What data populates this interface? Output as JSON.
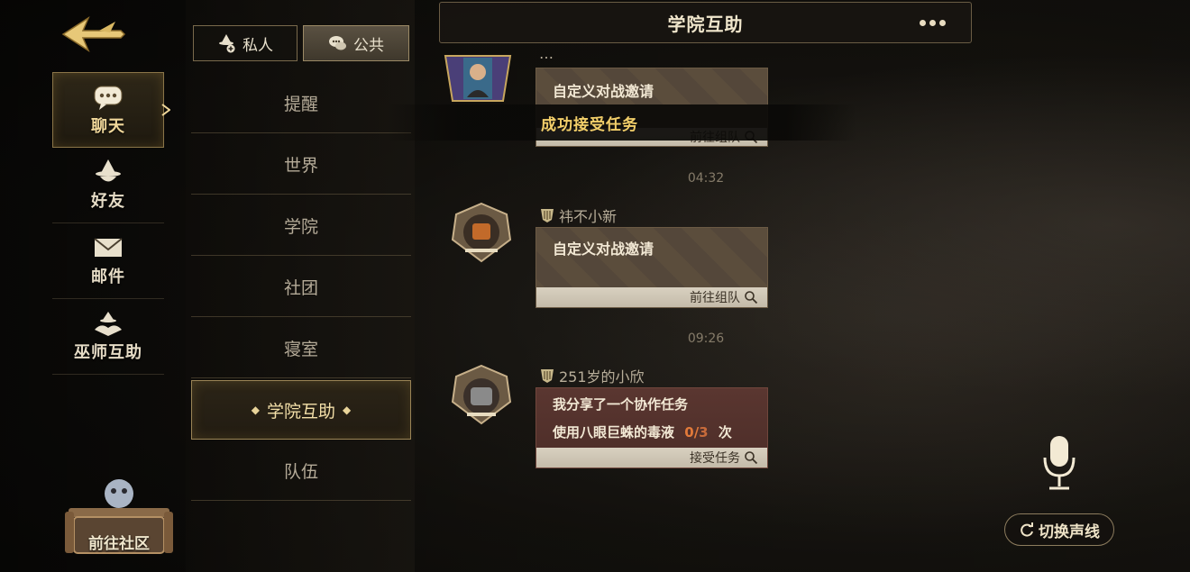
{
  "nav": {
    "items": [
      {
        "label": "聊天",
        "icon": "chat-bubble-icon"
      },
      {
        "label": "好友",
        "icon": "wizard-hat-icon"
      },
      {
        "label": "邮件",
        "icon": "envelope-icon"
      },
      {
        "label": "巫师互助",
        "icon": "wizard-help-icon"
      }
    ],
    "active_index": 0,
    "community_label": "前往社区"
  },
  "tabs": {
    "private_label": "私人",
    "public_label": "公共",
    "active": "public"
  },
  "channels": {
    "items": [
      "提醒",
      "世界",
      "学院",
      "社团",
      "寝室",
      "学院互助",
      "队伍"
    ],
    "active_index": 5
  },
  "chat": {
    "title": "学院互助",
    "messages": [
      {
        "sender": "…",
        "card_title": "自定义对战邀请",
        "action": "前往组队"
      },
      {
        "time": "04:32",
        "sender": "祎不小新",
        "card_title": "自定义对战邀请",
        "action": "前往组队"
      },
      {
        "time": "09:26",
        "sender": "251岁的小欣",
        "card_title": "我分享了一个协作任务",
        "task_text": "使用八眼巨蛛的毒液",
        "progress_current": "0",
        "progress_sep": "/",
        "progress_total": "3",
        "progress_unit": "次",
        "action": "接受任务"
      }
    ],
    "toast": "成功接受任务"
  },
  "voice": {
    "switch_label": "切换声线"
  },
  "colors": {
    "accent_gold": "#f0d79a",
    "toast_gold": "#f3cf6a",
    "progress_orange": "#e27a3a"
  }
}
